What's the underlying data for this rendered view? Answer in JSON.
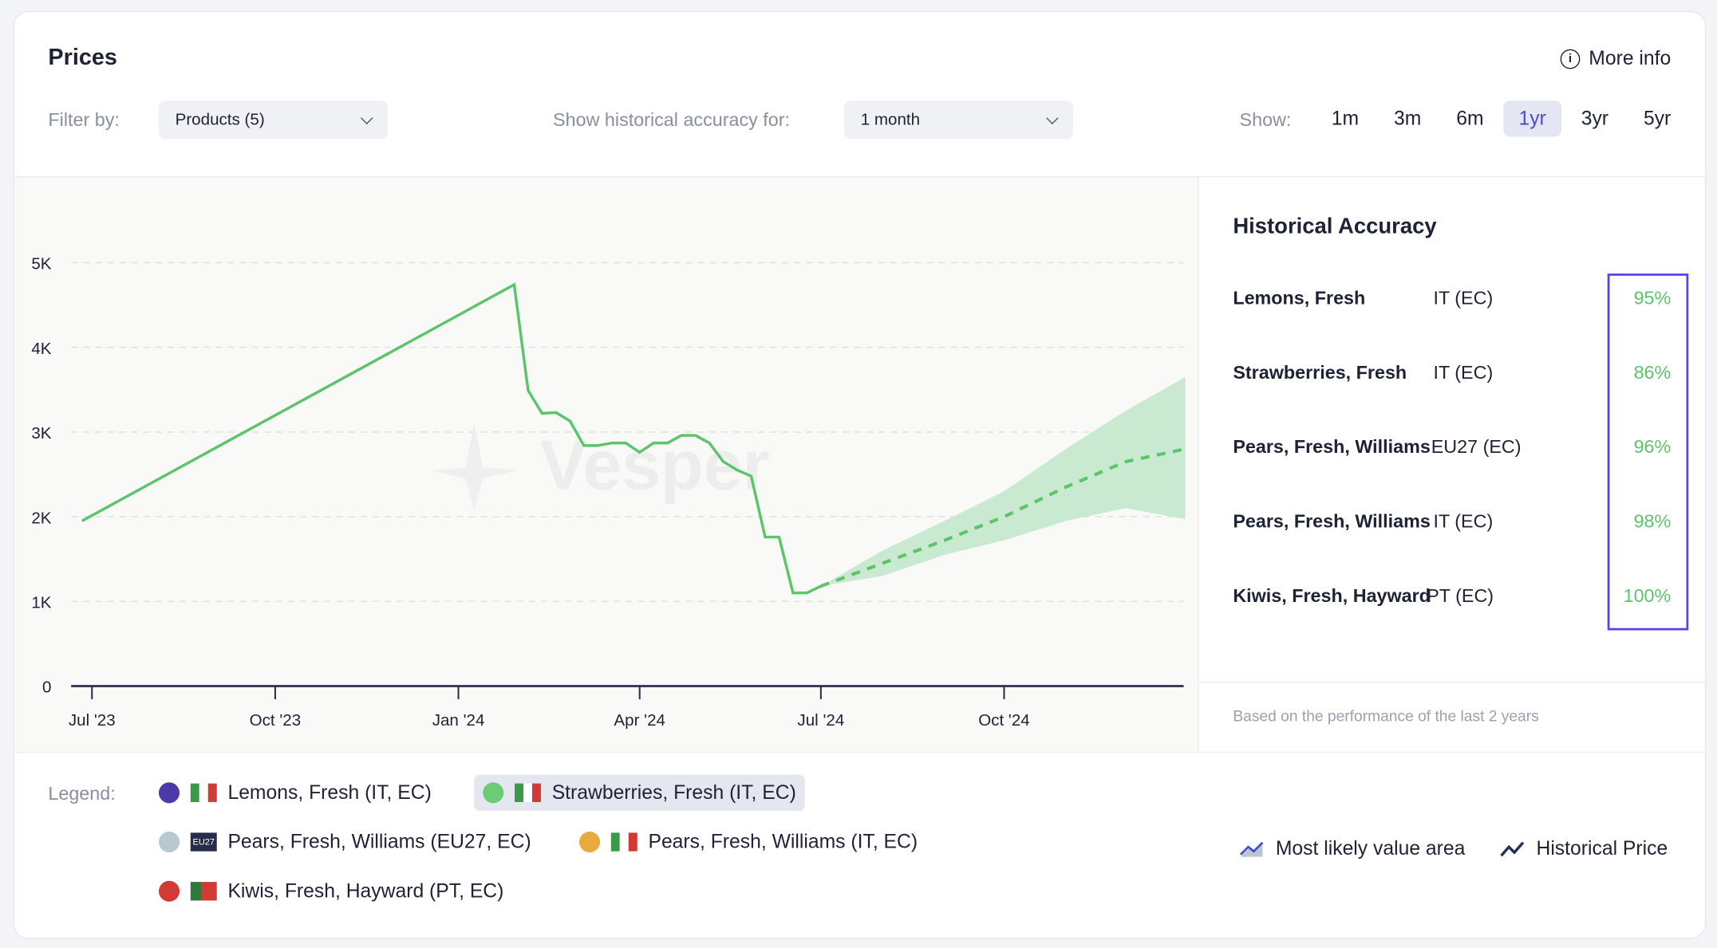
{
  "header": {
    "title": "Prices",
    "more_info": "More info",
    "filter_label": "Filter by:",
    "filter_value": "Products (5)",
    "accuracy_label": "Show historical accuracy for:",
    "accuracy_value": "1 month",
    "show_label": "Show:",
    "ranges": [
      "1m",
      "3m",
      "6m",
      "1yr",
      "3yr",
      "5yr"
    ],
    "active_range": "1yr"
  },
  "side": {
    "title": "Historical Accuracy",
    "rows": [
      {
        "name": "Lemons, Fresh",
        "country": "IT (EC)",
        "pct": "95%"
      },
      {
        "name": "Strawberries, Fresh",
        "country": "IT (EC)",
        "pct": "86%"
      },
      {
        "name": "Pears, Fresh, Williams",
        "country": "EU27 (EC)",
        "pct": "96%"
      },
      {
        "name": "Pears, Fresh, Williams",
        "country": "IT (EC)",
        "pct": "98%"
      },
      {
        "name": "Kiwis, Fresh, Hayward",
        "country": "PT (EC)",
        "pct": "100%"
      }
    ],
    "footnote": "Based on the performance of the last 2 years",
    "highlight_color": "#5b3ff5"
  },
  "legend": {
    "label": "Legend:",
    "items": [
      {
        "label": "Lemons, Fresh (IT, EC)",
        "color": "#4a3aa8",
        "flag": "IT",
        "selected": false
      },
      {
        "label": "Strawberries, Fresh (IT, EC)",
        "color": "#6ccb76",
        "flag": "IT",
        "selected": true
      },
      {
        "label": "Pears, Fresh, Williams (EU27, EC)",
        "color": "#b9c7cf",
        "flag": "EU27",
        "selected": false
      },
      {
        "label": "Pears, Fresh, Williams (IT, EC)",
        "color": "#e9a93c",
        "flag": "IT",
        "selected": false
      },
      {
        "label": "Kiwis, Fresh, Hayward (PT, EC)",
        "color": "#d33a35",
        "flag": "PT",
        "selected": false
      }
    ],
    "area_label": "Most likely value area",
    "historical_label": "Historical Price"
  },
  "watermark": "Vesper",
  "chart_data": {
    "type": "line",
    "ylim": [
      0,
      5000
    ],
    "yticks": [
      "0",
      "1K",
      "2K",
      "3K",
      "4K",
      "5K"
    ],
    "ytick_values": [
      0,
      1000,
      2000,
      3000,
      4000,
      5000
    ],
    "xticks": [
      "Jul '23",
      "Oct '23",
      "Jan '24",
      "Apr '24",
      "Jul '24",
      "Oct '24"
    ],
    "xtick_dates": [
      "2023-07-01",
      "2023-10-01",
      "2024-01-01",
      "2024-04-01",
      "2024-07-01",
      "2024-10-01"
    ],
    "xlim": [
      "2023-06-20",
      "2024-12-31"
    ],
    "grid": true,
    "color": "#5cc46a",
    "series": [
      {
        "name": "Strawberries, Fresh (IT, EC)",
        "kind": "historical",
        "points": [
          [
            "2023-06-26",
            1950
          ],
          [
            "2024-01-29",
            4740
          ],
          [
            "2024-02-05",
            3490
          ],
          [
            "2024-02-12",
            3220
          ],
          [
            "2024-02-19",
            3230
          ],
          [
            "2024-02-26",
            3130
          ],
          [
            "2024-03-04",
            2840
          ],
          [
            "2024-03-11",
            2840
          ],
          [
            "2024-03-18",
            2870
          ],
          [
            "2024-03-25",
            2870
          ],
          [
            "2024-04-01",
            2760
          ],
          [
            "2024-04-08",
            2870
          ],
          [
            "2024-04-15",
            2870
          ],
          [
            "2024-04-22",
            2960
          ],
          [
            "2024-04-29",
            2960
          ],
          [
            "2024-05-06",
            2870
          ],
          [
            "2024-05-13",
            2650
          ],
          [
            "2024-05-20",
            2550
          ],
          [
            "2024-05-27",
            2480
          ],
          [
            "2024-06-03",
            1760
          ],
          [
            "2024-06-10",
            1760
          ],
          [
            "2024-06-17",
            1100
          ],
          [
            "2024-06-24",
            1100
          ],
          [
            "2024-07-01",
            1180
          ]
        ]
      },
      {
        "name": "Strawberries, Fresh (IT, EC)",
        "kind": "forecast",
        "points": [
          [
            "2024-07-01",
            1180,
            1180,
            1180
          ],
          [
            "2024-08-01",
            1450,
            1300,
            1600
          ],
          [
            "2024-09-01",
            1720,
            1550,
            1950
          ],
          [
            "2024-10-01",
            2000,
            1720,
            2300
          ],
          [
            "2024-11-01",
            2350,
            1950,
            2800
          ],
          [
            "2024-12-01",
            2650,
            2100,
            3250
          ],
          [
            "2024-12-31",
            2800,
            1970,
            3650
          ]
        ]
      }
    ]
  }
}
